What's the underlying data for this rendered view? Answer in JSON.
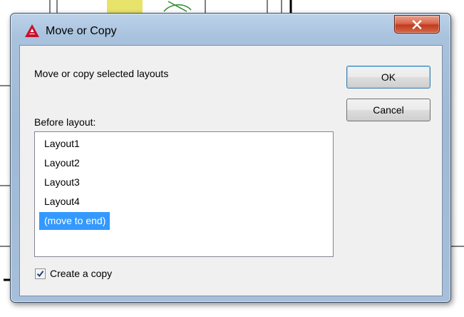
{
  "window": {
    "title": "Move or Copy",
    "close_label": "x"
  },
  "dialog": {
    "prompt": "Move or copy selected layouts",
    "before_label": "Before layout:",
    "layouts": [
      "Layout1",
      "Layout2",
      "Layout3",
      "Layout4",
      "(move to end)"
    ],
    "selected_layout": "(move to end)",
    "copy_checkbox": {
      "label": "Create a copy",
      "checked": true
    }
  },
  "buttons": {
    "ok": "OK",
    "cancel": "Cancel"
  },
  "colors": {
    "selection": "#3399ff",
    "close_button": "#c94a2e",
    "title_bar": "#a9c2dd",
    "app_icon": "#c8102e"
  },
  "icons": [
    "autocad-app-icon",
    "close-icon",
    "checkmark-icon"
  ]
}
